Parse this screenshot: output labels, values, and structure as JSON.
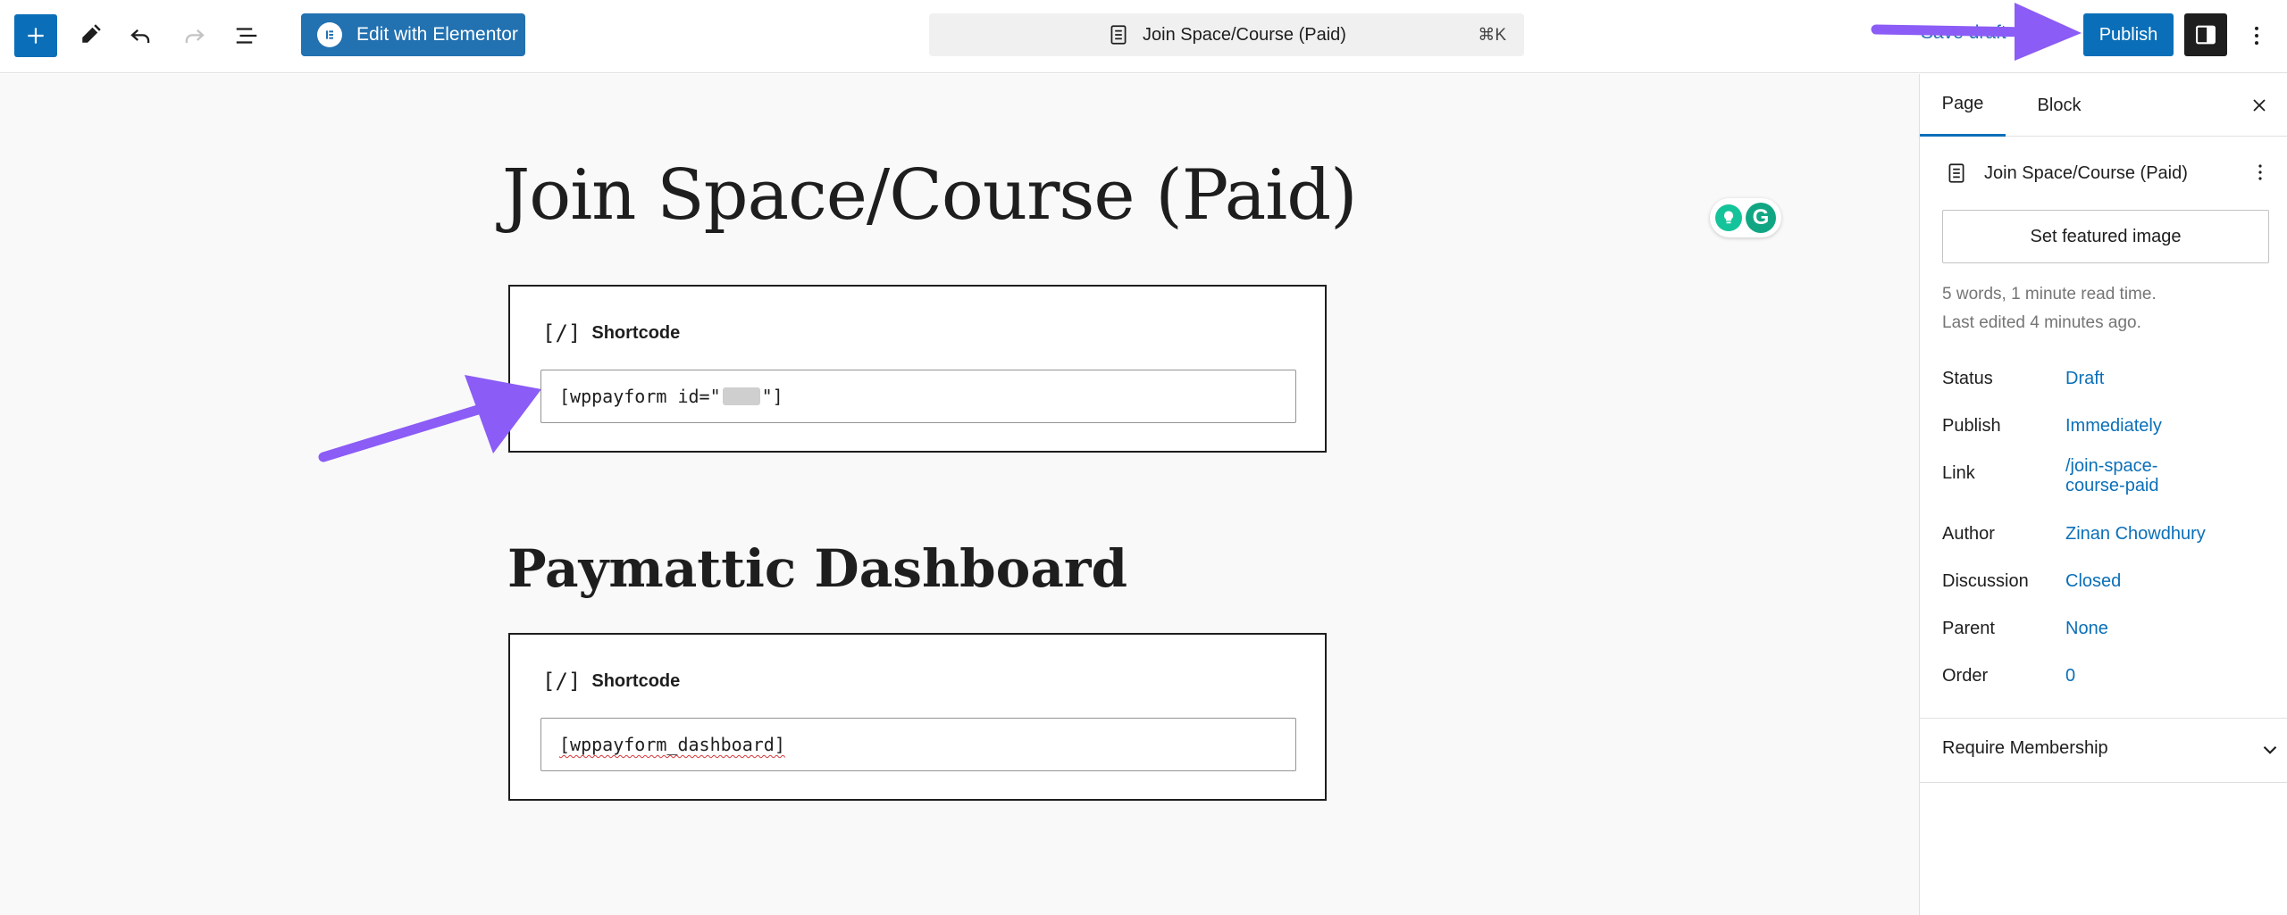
{
  "toolbar": {
    "elementor_label": "Edit with Elementor",
    "doc_title": "Join Space/Course (Paid)",
    "shortcut": "⌘K",
    "save_draft_label": "Save draft",
    "publish_label": "Publish"
  },
  "content": {
    "page_title": "Join Space/Course (Paid)",
    "shortcode1": {
      "label": "Shortcode",
      "value_prefix": "[wppayform id=\"",
      "value_suffix": "\"]"
    },
    "heading2": "Paymattic Dashboard",
    "shortcode2": {
      "label": "Shortcode",
      "value": "[wppayform_dashboard]"
    }
  },
  "sidebar": {
    "tabs": {
      "page": "Page",
      "block": "Block"
    },
    "doc_title": "Join Space/Course (Paid)",
    "featured_image_label": "Set featured image",
    "stats": "5 words, 1 minute read time.",
    "last_edited": "Last edited 4 minutes ago.",
    "rows": [
      {
        "label": "Status",
        "value": "Draft"
      },
      {
        "label": "Publish",
        "value": "Immediately"
      },
      {
        "label": "Link",
        "value": "/join-space-course-paid"
      },
      {
        "label": "Author",
        "value": "Zinan Chowdhury"
      },
      {
        "label": "Discussion",
        "value": "Closed"
      },
      {
        "label": "Parent",
        "value": "None"
      },
      {
        "label": "Order",
        "value": "0"
      }
    ],
    "require_membership": "Require Membership"
  },
  "colors": {
    "accent": "#0a6fb8",
    "annotation_arrow": "#8b5cf6"
  }
}
